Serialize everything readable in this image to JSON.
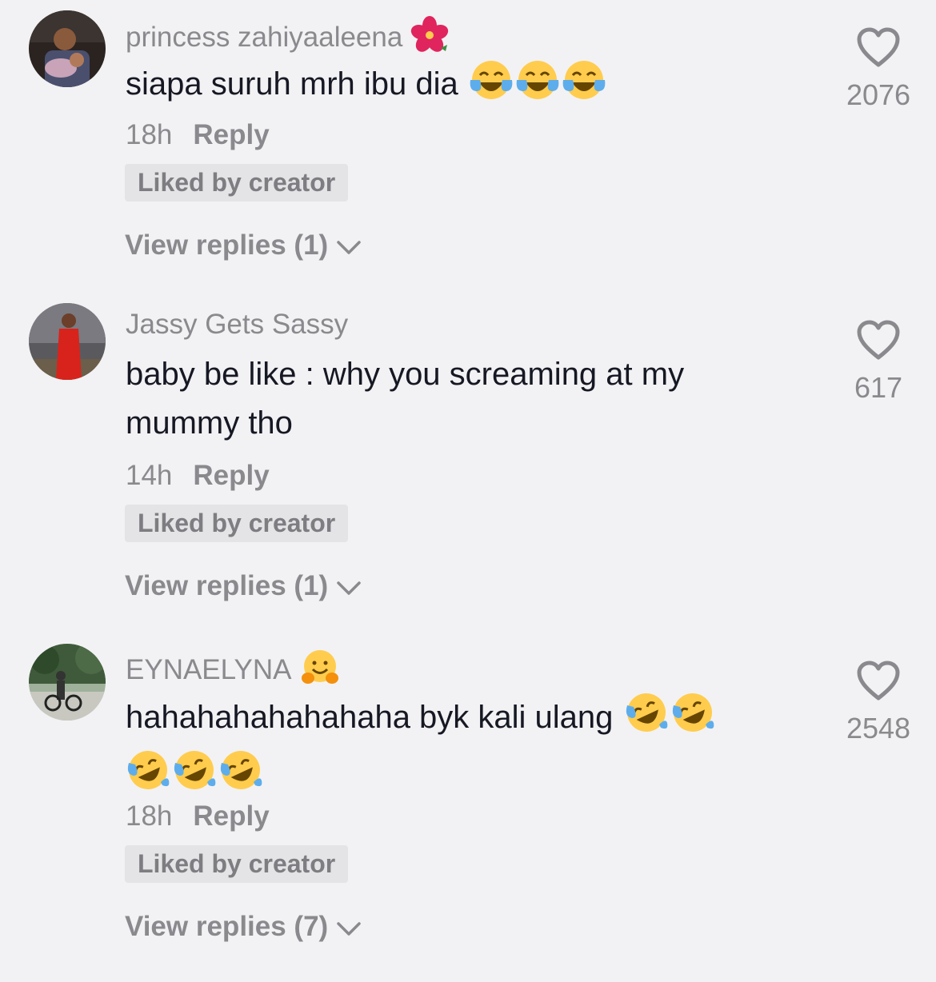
{
  "comments": [
    {
      "username": "princess zahiyaaleena",
      "username_emoji": "hibiscus",
      "text": "siapa suruh mrh ibu dia",
      "text_emojis": [
        "tears-of-joy",
        "tears-of-joy",
        "tears-of-joy"
      ],
      "time": "18h",
      "reply_label": "Reply",
      "liked_label": "Liked by creator",
      "view_replies": "View replies (1)",
      "likes": "2076"
    },
    {
      "username": "Jassy Gets Sassy",
      "text_line1": "baby be like : why you screaming at my",
      "text_line2": "mummy tho",
      "time": "14h",
      "reply_label": "Reply",
      "liked_label": "Liked by creator",
      "view_replies": "View replies (1)",
      "likes": "617"
    },
    {
      "username": "EYNAELYNA",
      "username_emoji": "hugging-face",
      "text": "hahahahahahahaha byk kali ulang",
      "text_emojis": [
        "rofl",
        "rofl",
        "rofl",
        "rofl",
        "rofl"
      ],
      "time": "18h",
      "reply_label": "Reply",
      "liked_label": "Liked by creator",
      "view_replies": "View replies (7)",
      "likes": "2548"
    }
  ]
}
